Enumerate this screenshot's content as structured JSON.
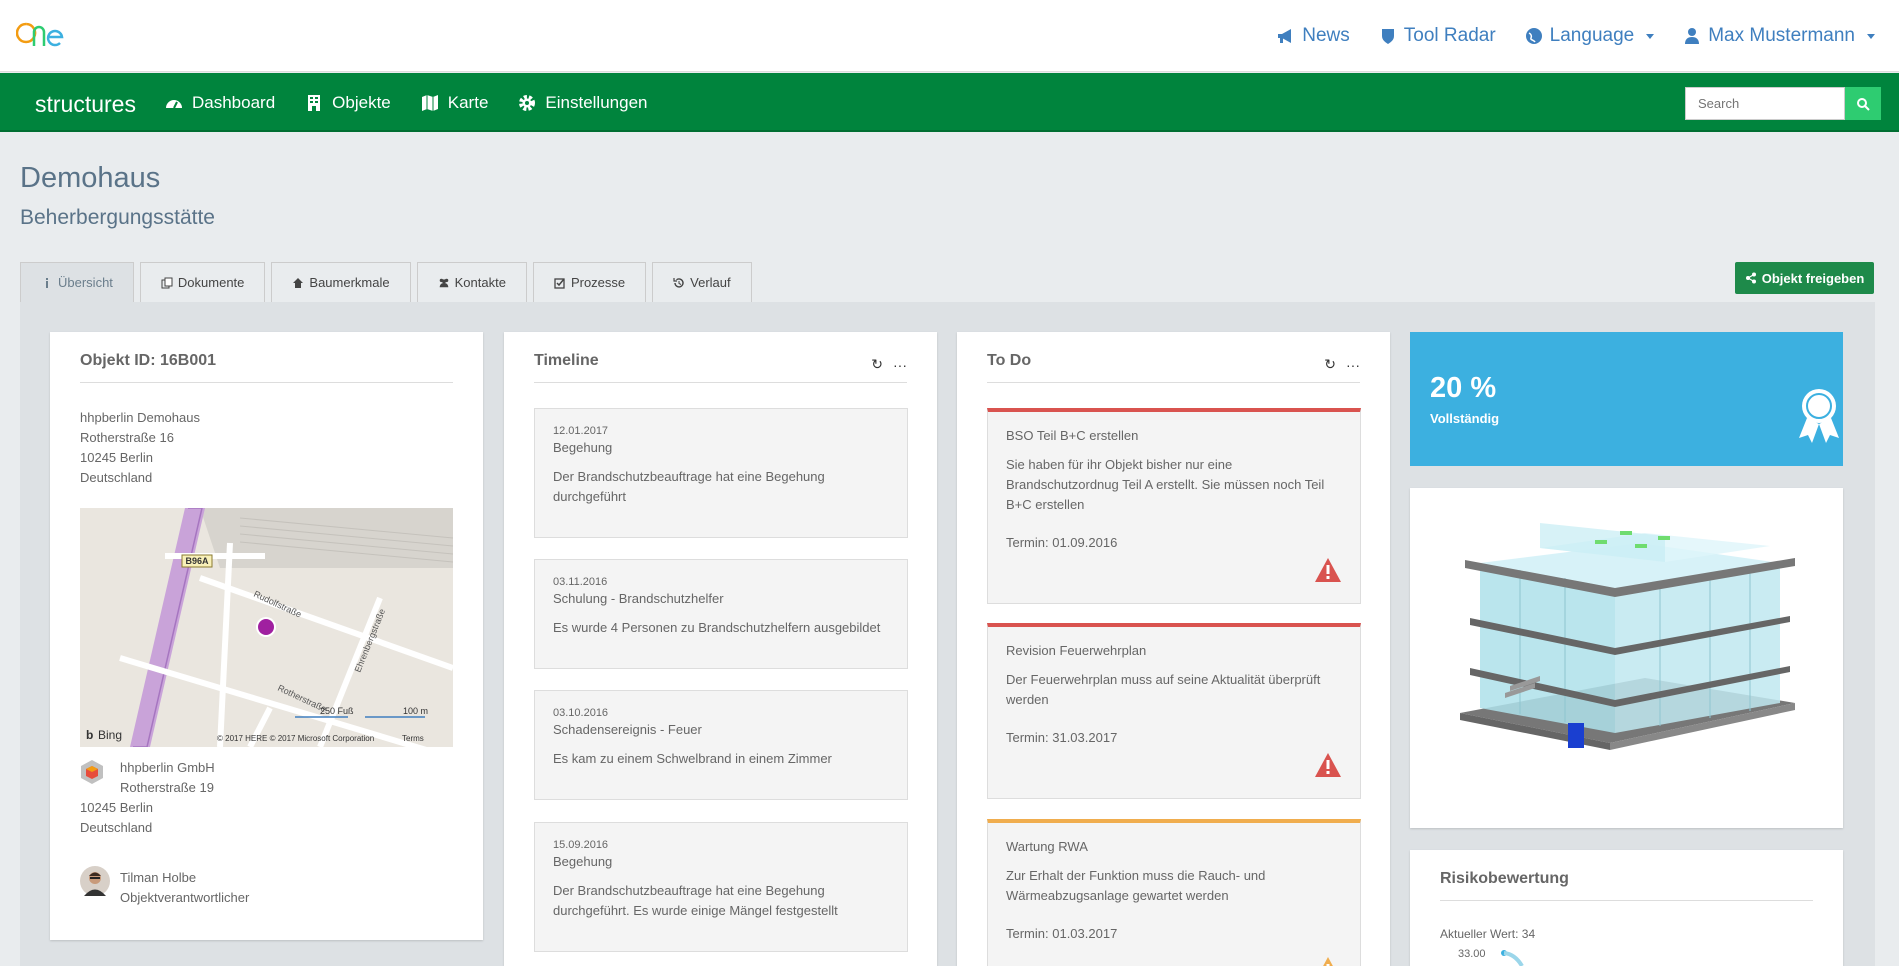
{
  "topnav": {
    "news": "News",
    "tool_radar": "Tool Radar",
    "language": "Language",
    "user": "Max Mustermann"
  },
  "mainnav": {
    "brand": "structures",
    "dashboard": "Dashboard",
    "objekte": "Objekte",
    "karte": "Karte",
    "einstellungen": "Einstellungen",
    "search_placeholder": "Search"
  },
  "page": {
    "title": "Demohaus",
    "subtitle": "Beherbergungsstätte",
    "freigeben": "Objekt freigeben"
  },
  "tabs": [
    "Übersicht",
    "Dokumente",
    "Baumerkmale",
    "Kontakte",
    "Prozesse",
    "Verlauf"
  ],
  "objekt": {
    "heading": "Objekt ID: 16B001",
    "address": [
      "hhpberlin Demohaus",
      "Rotherstraße 16",
      "10245 Berlin",
      "Deutschland"
    ],
    "map": {
      "road_label": "B96A",
      "street1": "Rudolfstraße",
      "street2": "Rotherstraße",
      "street3": "Ehrenbergstraße",
      "scale_ft": "250 Fuß",
      "scale_m": "100 m",
      "provider": "Bing",
      "copyright": "© 2017 HERE © 2017 Microsoft Corporation",
      "terms": "Terms"
    },
    "company": "hhpberlin GmbH",
    "company_street": "Rotherstraße 19",
    "company_city": "10245 Berlin",
    "company_country": "Deutschland",
    "person": "Tilman Holbe",
    "role": "Objektverantwortlicher"
  },
  "timeline": {
    "heading": "Timeline",
    "items": [
      {
        "date": "12.01.2017",
        "title": "Begehung",
        "text": "Der Brandschutzbeauftrage hat eine Begehung durchgeführt"
      },
      {
        "date": "03.11.2016",
        "title": "Schulung - Brandschutzhelfer",
        "text": "Es wurde 4 Personen zu Brandschutzhelfern ausgebildet"
      },
      {
        "date": "03.10.2016",
        "title": "Schadensereignis - Feuer",
        "text": "Es kam zu einem Schwelbrand in einem Zimmer"
      },
      {
        "date": "15.09.2016",
        "title": "Begehung",
        "text": "Der Brandschutzbeauftrage hat eine Begehung durchgeführt. Es wurde einige Mängel festgestellt"
      }
    ]
  },
  "todo": {
    "heading": "To Do",
    "items": [
      {
        "title": "BSO Teil B+C erstellen",
        "text": "Sie haben für ihr Objekt bisher nur eine Brandschutzordnug Teil A erstellt. Sie müssen noch Teil B+C erstellen",
        "termin": "Termin: 01.09.2016",
        "severity": "danger"
      },
      {
        "title": "Revision Feuerwehrplan",
        "text": "Der Feuerwehrplan muss auf seine Aktualität überprüft werden",
        "termin": "Termin: 31.03.2017",
        "severity": "danger"
      },
      {
        "title": "Wartung RWA",
        "text": "Zur Erhalt der Funktion muss die Rauch- und Wärmeabzugsanlage gewartet werden",
        "termin": "Termin: 01.03.2017",
        "severity": "warning"
      }
    ]
  },
  "status": {
    "percent": "20 %",
    "label": "Vollständig",
    "completion": 0.2
  },
  "risk": {
    "heading": "Risikobewertung",
    "current": "Aktueller Wert: 34",
    "tick": "33.00"
  },
  "colors": {
    "green": "#00843d",
    "blue": "#3cb0e0",
    "danger": "#d9534f",
    "warning": "#f0ad4e",
    "link": "#3f7fbf"
  }
}
